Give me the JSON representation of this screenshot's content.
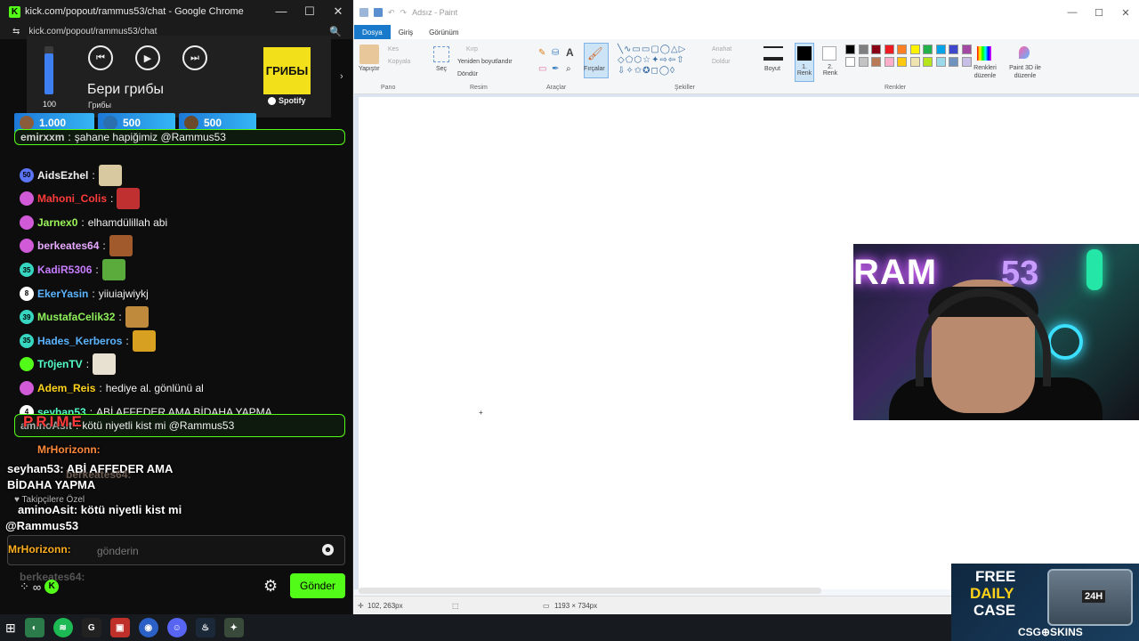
{
  "chrome": {
    "window_title": "kick.com/popout/rammus53/chat - Google Chrome",
    "url": "kick.com/popout/rammus53/chat",
    "controls": [
      "—",
      "☐",
      "✕"
    ]
  },
  "spotify": {
    "volume_label": "100",
    "volume_level": 0.85,
    "track_title": "Бери грибы",
    "artist": "Грибы",
    "album_art_text": "ГРИБЫ",
    "brand": "Spotify"
  },
  "tips": [
    "1.000",
    "500",
    "500"
  ],
  "chat": {
    "messages": [
      {
        "user": "emirxxm",
        "text": "şahane hapiğimiz @Rammus53",
        "color": "#cfcfcf",
        "badge": "",
        "pinned": true
      },
      {
        "user": "AidsEzhel",
        "text": "",
        "color": "#f2f2f2",
        "badge": "50",
        "badge_color": "#5a74f5",
        "emote": "#d8c9a0"
      },
      {
        "user": "Mahoni_Colis",
        "text": "",
        "color": "#ff3b3b",
        "badge": "",
        "badge_color": "#d05ad8",
        "emote": "#c03030"
      },
      {
        "user": "Jarnex0",
        "text": "elhamdülillah abi",
        "color": "#9bf55a",
        "badge": "",
        "badge_color": "#d05ad8"
      },
      {
        "user": "berkeates64",
        "text": "",
        "color": "#e7a9ff",
        "badge": "",
        "badge_color": "#d05ad8",
        "emote": "#a05a2c"
      },
      {
        "user": "KadiR5306",
        "text": "",
        "color": "#c77dff",
        "badge": "35",
        "badge_color": "#36d6c0",
        "emote": "#5aaa3c"
      },
      {
        "user": "EkerYasin",
        "text": "yiiuiajwiykj",
        "color": "#5ab4ff",
        "badge": "8",
        "badge_color": "#ffffff"
      },
      {
        "user": "MustafaCelik32",
        "text": "",
        "color": "#8ef05a",
        "badge": "39",
        "badge_color": "#36d6c0",
        "emote": "#c08a3c"
      },
      {
        "user": "Hades_Kerberos",
        "text": "",
        "color": "#5ab4ff",
        "badge": "35",
        "badge_color": "#36d6c0",
        "emote": "#d8a020"
      },
      {
        "user": "Tr0jenTV",
        "text": "",
        "color": "#53fcc8",
        "badge": "",
        "badge_color": "#53fc18",
        "emote": "#e8e0d0"
      },
      {
        "user": "Adem_Reis",
        "text": "hediye al. gönlünü al",
        "color": "#ffd21a",
        "badge": "",
        "badge_color": "#d05ad8"
      },
      {
        "user": "seyhan53",
        "text": "ABİ AFFEDER AMA BİDAHA YAPMA",
        "color": "#53fcc8",
        "badge": "4",
        "badge_color": "#ffffff"
      },
      {
        "user": "aminoAsit",
        "text": "kötü niyetli kist mi @Rammus53",
        "color": "#b0b0b0",
        "badge": "",
        "pinned": true
      }
    ],
    "overlay": {
      "prime": "PRIME",
      "mrhorizonn": "MrHorizonn:",
      "seyhan_line1": "seyhan53: ABİ AFFEDER AMA",
      "seyhan_line2": "BİDAHA YAPMA",
      "berkeates_ghost": "berkeates64:",
      "followers": "♥ Takipçilere Özel",
      "amino_line1": "aminoAsit: kötü niyetli kist mi",
      "amino_line2": "@Rammus53",
      "mrhorizonn2": "MrHorizonn:",
      "berkeates_ghost2": "berkeates64:"
    },
    "input_placeholder": "gönderin",
    "send_label": "Gönder"
  },
  "paint": {
    "title": "Adsız - Paint",
    "tabs": [
      "Dosya",
      "Giriş",
      "Görünüm"
    ],
    "groups": {
      "pano": "Pano",
      "resim": "Resim",
      "araclar": "Araçlar",
      "sekiller": "Şekiller",
      "renkler": "Renkler"
    },
    "buttons": {
      "yapistir": "Yapıştır",
      "kes": "Kes",
      "kopyala": "Kopyala",
      "sec": "Seç",
      "kirp": "Kırp",
      "yeniden": "Yeniden boyutlandır",
      "dondur": "Döndür",
      "fircalar": "Fırçalar",
      "anahat": "Anahat",
      "doldur": "Doldur",
      "boyut": "Boyut",
      "renk1": "1. Renk",
      "renk2": "2. Renk",
      "renkleri_duzenle": "Renkleri düzenle",
      "paint3d": "Paint 3D ile düzenle"
    },
    "palette": [
      "#000000",
      "#7f7f7f",
      "#880015",
      "#ed1c24",
      "#ff7f27",
      "#fff200",
      "#22b14c",
      "#00a2e8",
      "#3f48cc",
      "#a349a4",
      "#ffffff",
      "#c3c3c3",
      "#b97a57",
      "#ffaec9",
      "#ffc90e",
      "#efe4b0",
      "#b5e61d",
      "#99d9ea",
      "#7092be",
      "#c8bfe7"
    ],
    "status_position": "102, 263px",
    "status_size": "1193 × 734px"
  },
  "ad": {
    "line1": "FREE",
    "line2": "DAILY",
    "line3": "CASE",
    "box_label": "24H",
    "brand": "CSG⊕SKINS"
  },
  "taskbar": {
    "icons": [
      "windows-icon",
      "app-icon",
      "spotify-icon",
      "game-icon",
      "voice-icon",
      "chrome-icon",
      "discord-icon",
      "steam-icon",
      "app2-icon"
    ]
  }
}
